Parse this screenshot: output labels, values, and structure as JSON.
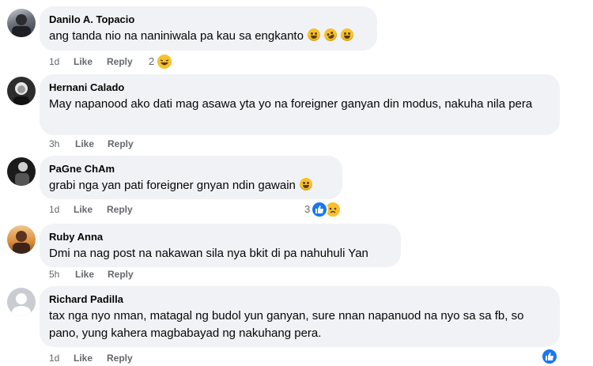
{
  "comments": [
    {
      "author": "Danilo A. Topacio",
      "text": "ang tanda nio na naniniwala pa kau sa engkanto",
      "time": "1d",
      "like": "Like",
      "reply": "Reply",
      "reaction_count": "2"
    },
    {
      "author": "Hernani Calado",
      "text": "May napanood ako dati mag asawa yta yo na foreigner ganyan din modus, nakuha nila pera",
      "time": "3h",
      "like": "Like",
      "reply": "Reply"
    },
    {
      "author": "PaGne ChAm",
      "text": "grabi nga yan pati foreigner gnyan ndin gawain",
      "time": "1d",
      "like": "Like",
      "reply": "Reply",
      "reaction_count": "3"
    },
    {
      "author": "Ruby Anna",
      "text": "Dmi na nag post na nakawan sila nya bkit di pa nahuhuli Yan",
      "time": "5h",
      "like": "Like",
      "reply": "Reply"
    },
    {
      "author": "Richard Padilla",
      "text": "tax nga nyo nman, matagal ng budol yun ganyan, sure nnan napanuod na nyo sa sa fb, so pano, yung kahera magbabayad ng nakuhang pera.",
      "time": "1d",
      "like": "Like",
      "reply": "Reply"
    }
  ],
  "colors": {
    "bubble": "#f0f2f5",
    "meta_text": "#65676b",
    "like_blue": "#1877f2"
  }
}
